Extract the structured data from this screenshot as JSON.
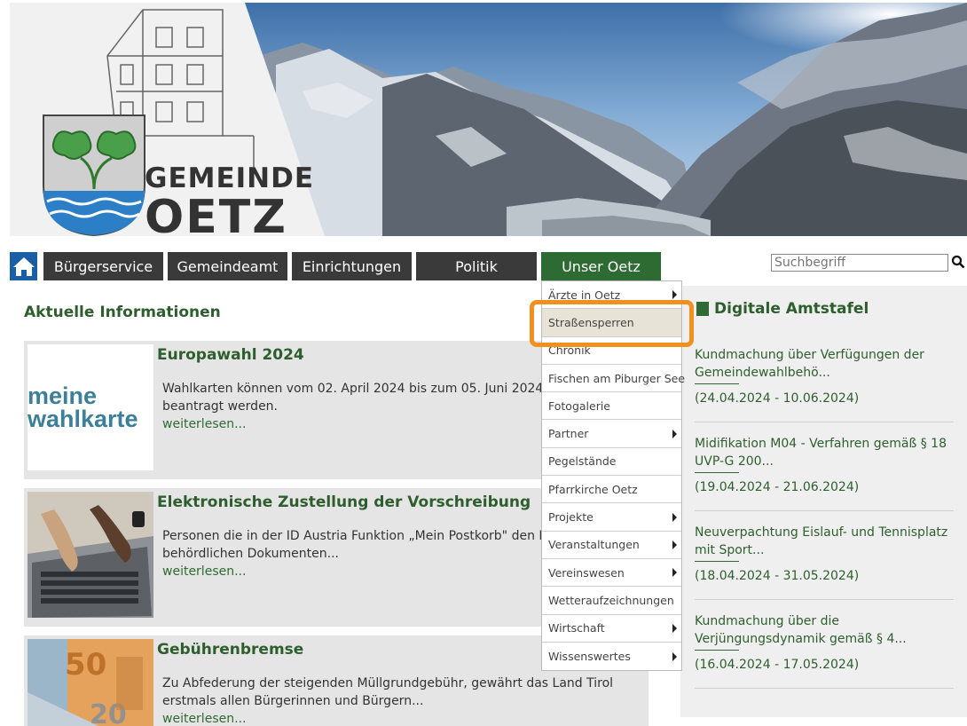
{
  "header": {
    "logo_line1": "GEMEINDE",
    "logo_line2": "OETZ"
  },
  "nav": {
    "items": [
      {
        "label": "Bürgerservice"
      },
      {
        "label": "Gemeindeamt"
      },
      {
        "label": "Einrichtungen"
      },
      {
        "label": "Politik"
      },
      {
        "label": "Unser Oetz"
      }
    ]
  },
  "search": {
    "placeholder": "Suchbegriff"
  },
  "main": {
    "section_title": "Aktuelle Informationen",
    "news": [
      {
        "title": "Europawahl 2024",
        "text": "Wahlkarten können vom 02. April 2024 bis zum 05. Juni 2024 (24:00 Uhr) beantragt werden.",
        "more": "weiterlesen...",
        "thumb_text_1": "meine",
        "thumb_text_2": "wahlkarte"
      },
      {
        "title": "Elektronische Zustellung der Vorschreibung",
        "text": "Personen die in der ID Austria Funktion „Mein Postkorb\" den Empfang von behördlichen Dokumenten...",
        "more": "weiterlesen..."
      },
      {
        "title": "Gebührenbremse",
        "text": "Zu Abfederung der steigenden Müllgrundgebühr, gewährt das Land Tirol erstmals allen Bürgerinnen und Bürgern...",
        "more": "weiterlesen..."
      }
    ]
  },
  "amtstafel": {
    "title": "Digitale Amtstafel",
    "items": [
      {
        "title": "Kundmachung über Verfügungen der Gemeindewahlbehö...",
        "date": "(24.04.2024 - 10.06.2024)"
      },
      {
        "title": "Midifikation M04 - Verfahren gemäß § 18 UVP-G 200...",
        "date": "(19.04.2024 - 21.06.2024)"
      },
      {
        "title": "Neuverpachtung Eislauf- und Tennisplatz mit Sport...",
        "date": "(18.04.2024 - 31.05.2024)"
      },
      {
        "title": "Kundmachung über die Verjüngungsdynamik gemäß § 4...",
        "date": "(16.04.2024 - 17.05.2024)"
      }
    ]
  },
  "dropdown": {
    "items": [
      {
        "label": "Ärzte in Oetz",
        "submenu": true
      },
      {
        "label": "Straßensperren",
        "submenu": false,
        "highlighted": true
      },
      {
        "label": "Chronik",
        "submenu": false
      },
      {
        "label": "Fischen am Piburger See",
        "submenu": false
      },
      {
        "label": "Fotogalerie",
        "submenu": false
      },
      {
        "label": "Partner",
        "submenu": true
      },
      {
        "label": "Pegelstände",
        "submenu": false
      },
      {
        "label": "Pfarrkirche Oetz",
        "submenu": false
      },
      {
        "label": "Projekte",
        "submenu": true
      },
      {
        "label": "Veranstaltungen",
        "submenu": true
      },
      {
        "label": "Vereinswesen",
        "submenu": true
      },
      {
        "label": "Wetteraufzeichnungen",
        "submenu": false
      },
      {
        "label": "Wirtschaft",
        "submenu": true
      },
      {
        "label": "Wissenswertes",
        "submenu": true
      }
    ]
  },
  "colors": {
    "brand_green": "#2e6b33",
    "nav_dark": "#3a3a3a",
    "home_blue": "#1a5fa6",
    "highlight_orange": "#f0901e"
  }
}
